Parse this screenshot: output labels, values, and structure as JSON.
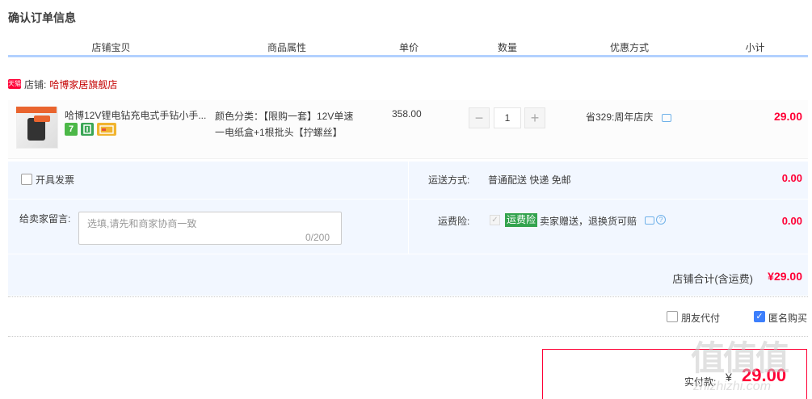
{
  "title": "确认订单信息",
  "columns": [
    "店铺宝贝",
    "商品属性",
    "单价",
    "数量",
    "优惠方式",
    "小计"
  ],
  "shop": {
    "badge": "天猫",
    "label": "店铺:",
    "name": "哈博家居旗舰店"
  },
  "item": {
    "name": "哈博12V锂电钻充电式手钻小手...",
    "tag7": "7",
    "attr_line1": "颜色分类：【限购一套】12V单速",
    "attr_line2": "一电纸盒+1根批头【拧螺丝】",
    "price": "358.00",
    "qty_minus": "−",
    "qty": "1",
    "qty_plus": "+",
    "promo": "省329:周年店庆",
    "subtotal": "29.00"
  },
  "invoice": {
    "label": "开具发票"
  },
  "shipping": {
    "label": "运送方式:",
    "value": "普通配送 快递 免邮",
    "fee": "0.00"
  },
  "message": {
    "label": "给卖家留言:",
    "placeholder": "选填,请先和商家协商一致",
    "count": "0/200"
  },
  "insurance": {
    "label": "运费险:",
    "badge": "运费险",
    "text": "卖家赠送，退换货可赔",
    "fee": "0.00"
  },
  "shop_total": {
    "label": "店铺合计(含运费)",
    "value": "¥29.00"
  },
  "options": {
    "friend_pay": "朋友代付",
    "anonymous": "匿名购买"
  },
  "pay": {
    "label": "实付款:",
    "yen": "¥",
    "value": "29.00"
  },
  "watermark": {
    "text": "值值值",
    "site": "zhizhizhi.com"
  },
  "colors": {
    "accent_red": "#ff0036",
    "shop_red": "#c40000",
    "panel_bg": "#f2f7ff",
    "header_line": "#b2d1ff"
  }
}
